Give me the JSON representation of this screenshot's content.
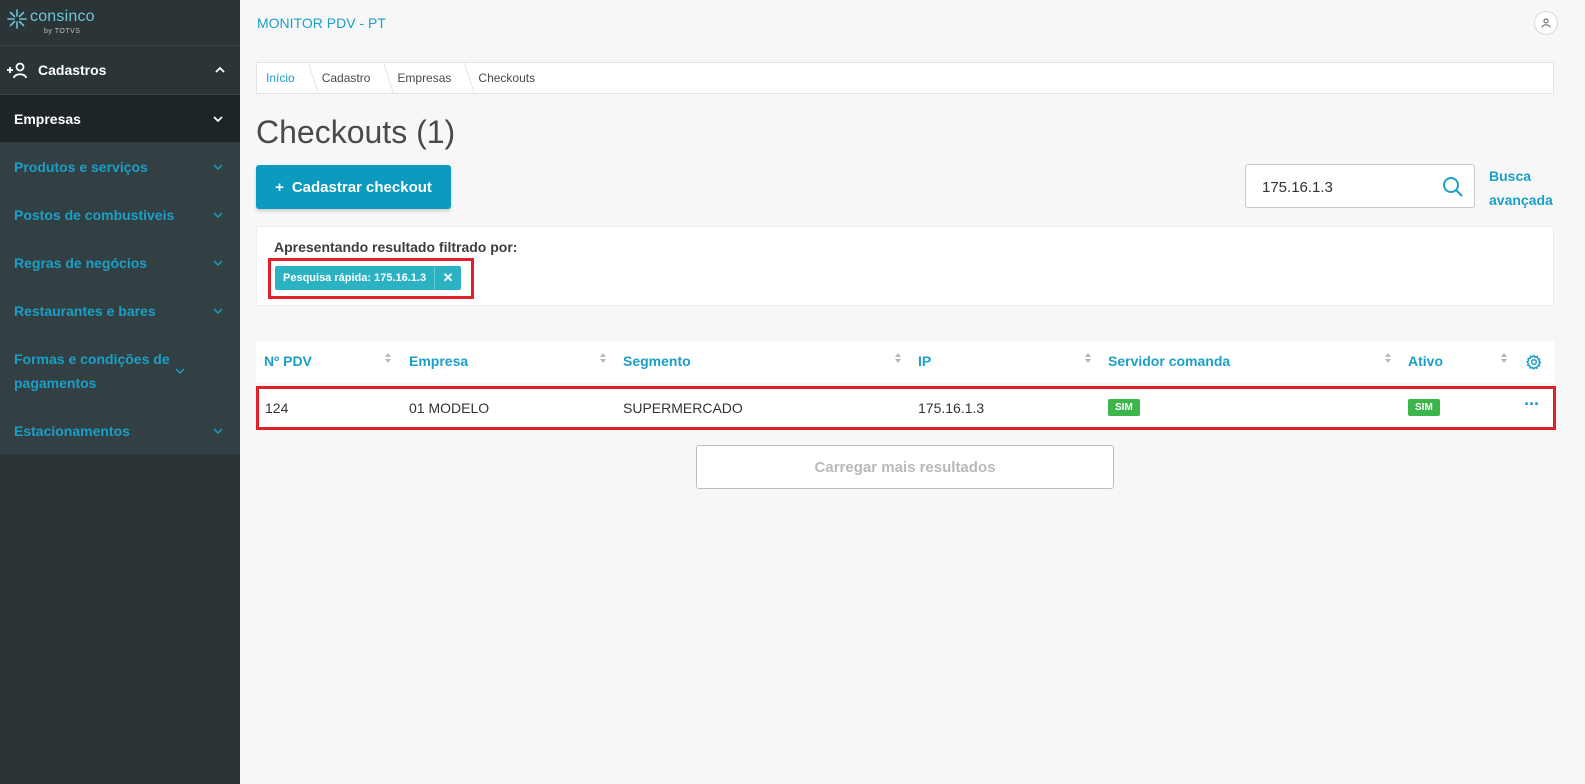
{
  "logo": {
    "brand": "consinco",
    "sub": "by TOTVS"
  },
  "sidebar": {
    "group": {
      "label": "Cadastros",
      "icon": "add-user-icon"
    },
    "items": [
      {
        "label": "Empresas",
        "active": true
      },
      {
        "label": "Produtos e serviços"
      },
      {
        "label": "Postos de combustiveis"
      },
      {
        "label": "Regras de negócios"
      },
      {
        "label": "Restaurantes e bares"
      },
      {
        "label": "Formas e condições de pagamentos"
      },
      {
        "label": "Estacionamentos"
      }
    ]
  },
  "header": {
    "app_title": "MONITOR PDV - PT",
    "user_icon": "user-icon"
  },
  "breadcrumb": [
    "Início",
    "Cadastro",
    "Empresas",
    "Checkouts"
  ],
  "page": {
    "title": "Checkouts (1)",
    "add_button": "Cadastrar checkout",
    "add_button_icon": "+"
  },
  "search": {
    "value": "175.16.1.3",
    "icon": "search-icon",
    "advanced_label": "Busca avançada"
  },
  "filter": {
    "label": "Apresentando resultado filtrado por:",
    "chip": "Pesquisa rápida: 175.16.1.3",
    "chip_close": "✕"
  },
  "table": {
    "columns": [
      "Nº PDV",
      "Empresa",
      "Segmento",
      "IP",
      "Servidor comanda",
      "Ativo"
    ],
    "rows": [
      {
        "pdv": "124",
        "empresa": "01 MODELO",
        "segmento": "SUPERMERCADO",
        "ip": "175.16.1.3",
        "servidor": "SIM",
        "ativo": "SIM",
        "menu": "···"
      }
    ]
  },
  "load_more": "Carregar mais resultados",
  "colors": {
    "accent": "#1a9fc7",
    "primary_button": "#0c9abe",
    "sidebar_bg": "#2b3538",
    "badge_green": "#3cb54a",
    "highlight_red": "#e0202a",
    "chip": "#2bb3c4"
  }
}
